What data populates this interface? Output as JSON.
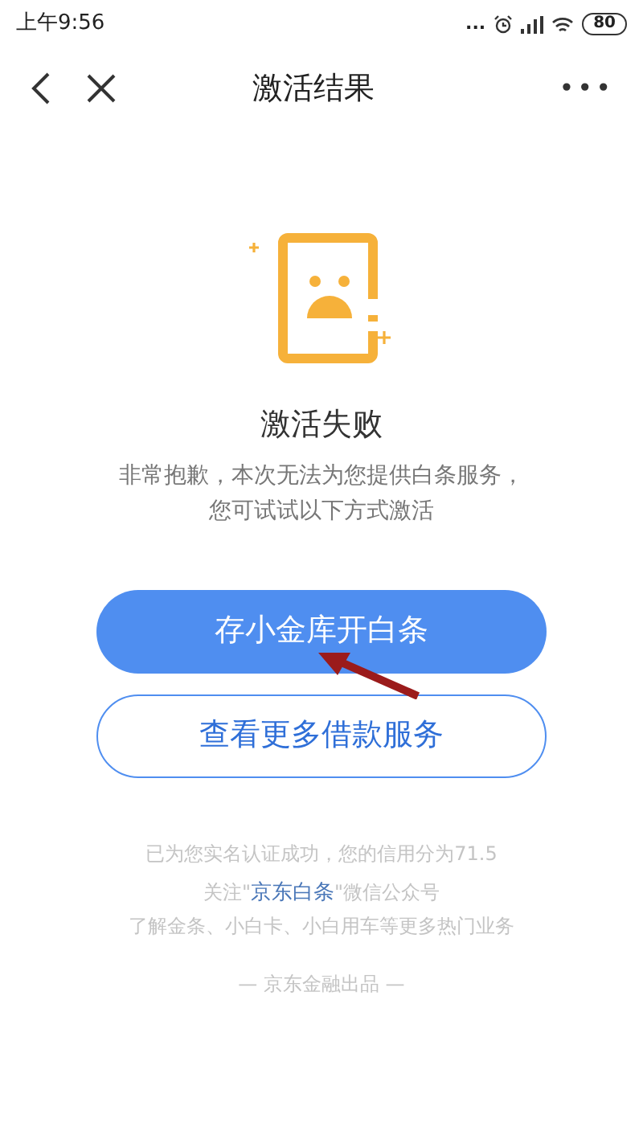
{
  "status_bar": {
    "time": "上午9:56",
    "more": "...",
    "battery": "80"
  },
  "nav": {
    "title": "激活结果",
    "more": "•••"
  },
  "result": {
    "title": "激活失败",
    "lines": [
      "非常抱歉，本次无法为您提供白条服务，",
      "您可试试以下方式激活"
    ]
  },
  "buttons": [
    {
      "label": "存小金库开白条",
      "kind": "primary"
    },
    {
      "label": "查看更多借款服务",
      "kind": "outline"
    }
  ],
  "footer": {
    "credit": "已为您实名认证成功，您的信用分为71.5",
    "follow_prefix": "关注\"",
    "follow_link": "京东白条",
    "follow_suffix": "\"微信公众号",
    "promo": "了解金条、小白卡、小白用车等更多热门业务",
    "brand": "— 京东金融出品 —"
  }
}
